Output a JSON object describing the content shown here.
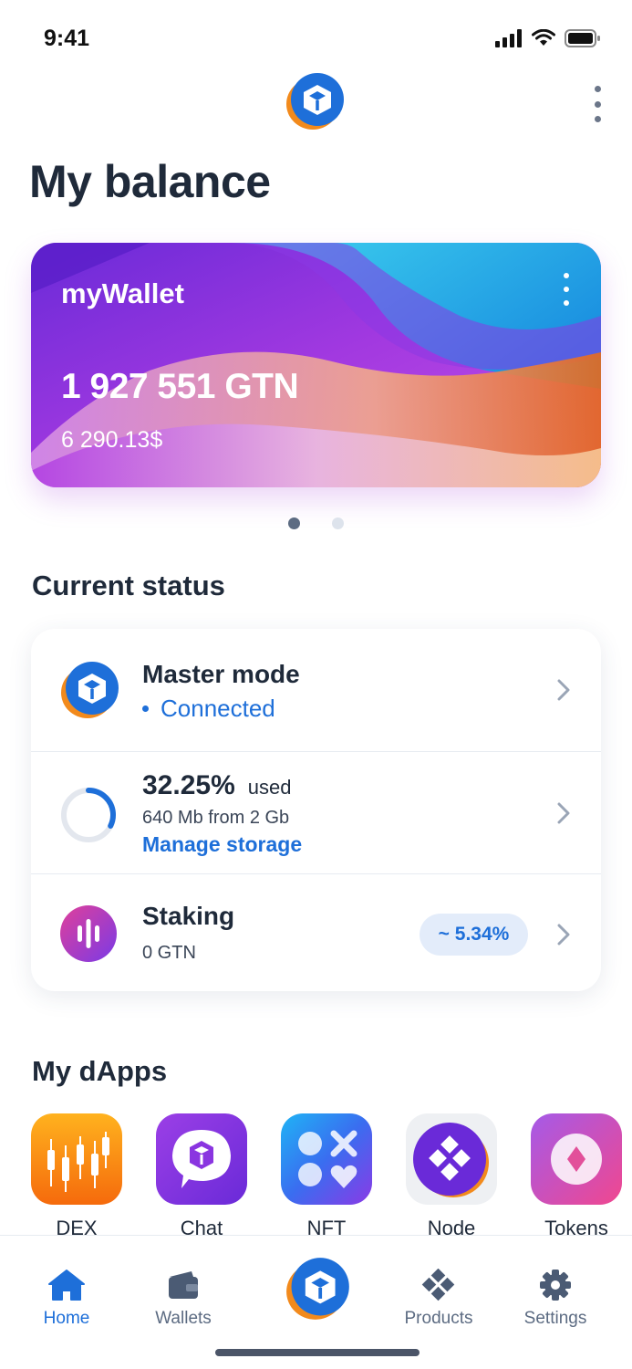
{
  "status_bar": {
    "time": "9:41"
  },
  "header": {
    "title": "My balance"
  },
  "wallet_card": {
    "name": "myWallet",
    "amount": "1 927 551 GTN",
    "fiat": "6 290.13$",
    "pages": 2,
    "active_page": 1
  },
  "current_status": {
    "heading": "Current status",
    "master_mode": {
      "title": "Master mode",
      "status": "Connected"
    },
    "storage": {
      "percent_label": "32.25%",
      "used_label": "used",
      "detail": "640  Mb from 2  Gb",
      "manage_label": "Manage storage",
      "fraction_used": 0.3225
    },
    "staking": {
      "title": "Staking",
      "amount": "0 GTN",
      "rate": "~ 5.34%"
    }
  },
  "dapps": {
    "heading": "My dApps",
    "items": [
      {
        "label": "DEX",
        "icon": "candlestick-chart-icon"
      },
      {
        "label": "Chat",
        "icon": "chat-bubble-icon"
      },
      {
        "label": "NFT",
        "icon": "shapes-icon"
      },
      {
        "label": "Node",
        "icon": "node-diamond-icon"
      },
      {
        "label": "Tokens",
        "icon": "token-coin-icon"
      }
    ]
  },
  "tabbar": {
    "home": "Home",
    "wallets": "Wallets",
    "products": "Products",
    "settings": "Settings"
  },
  "colors": {
    "accent": "#1e6fd9",
    "text": "#1f2a3a",
    "muted": "#5c6b82",
    "logo_orange": "#f28a1c",
    "logo_blue": "#1e6fd9"
  }
}
